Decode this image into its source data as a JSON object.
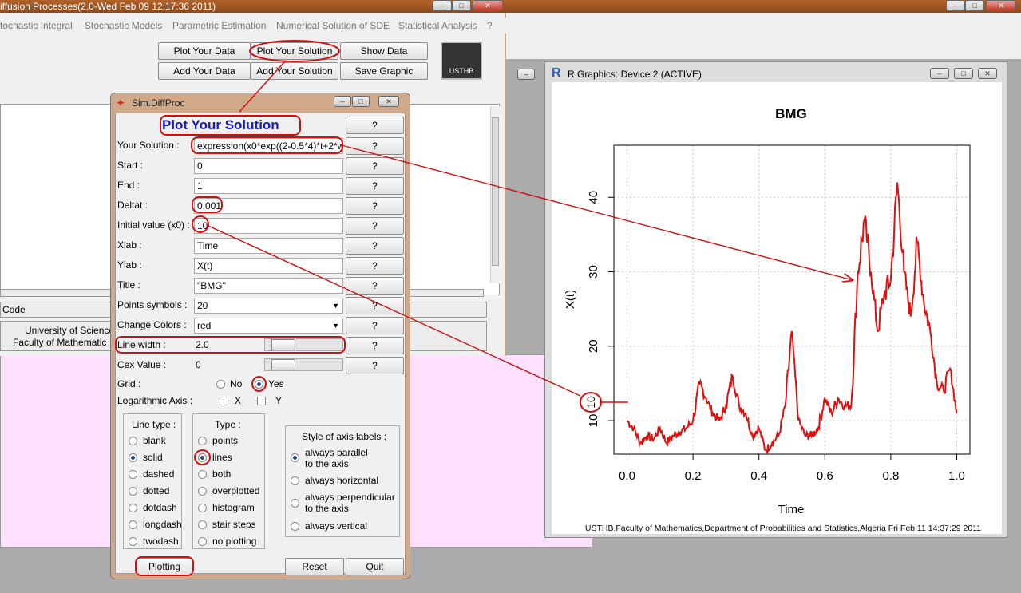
{
  "top_window": {
    "title": "iffusion Processes(2.0-Wed Feb 09 12:17:36 2011)"
  },
  "menu": [
    "tochastic Integral",
    "Stochastic Models",
    "Parametric Estimation",
    "Numerical Solution of SDE",
    "Statistical Analysis",
    "?"
  ],
  "toolbar": {
    "plot_data": "Plot Your Data",
    "plot_solution": "Plot Your Solution",
    "show_data": "Show Data",
    "add_data": "Add Your Data",
    "add_solution": "Add Your Solution",
    "save_graphic": "Save Graphic",
    "logo_text": "USTHB"
  },
  "main_footer": {
    "code_label": "Code",
    "univ": "University of Science",
    "faculty": "Faculty of Mathematic"
  },
  "dialog": {
    "title": "Sim.DiffProc",
    "heading": "Plot Your Solution",
    "help": "?",
    "fields": [
      {
        "label": "Your Solution :",
        "value": "expression(x0*exp((2-0.5*4)*t+2*w"
      },
      {
        "label": "Start :",
        "value": "0"
      },
      {
        "label": "End :",
        "value": "1"
      },
      {
        "label": "Deltat :",
        "value": "0.001"
      },
      {
        "label": "Initial value (x0) :",
        "value": "10"
      },
      {
        "label": "Xlab :",
        "value": "Time"
      },
      {
        "label": "Ylab :",
        "value": "X(t)"
      },
      {
        "label": "Title :",
        "value": "\"BMG\""
      }
    ],
    "points_symbols": {
      "label": "Points symbols :",
      "value": "20"
    },
    "change_colors": {
      "label": "Change Colors :",
      "value": "red"
    },
    "line_width": {
      "label": "Line width :",
      "value": "2.0",
      "level": 0.12
    },
    "cex_value": {
      "label": "Cex Value :",
      "value": "0",
      "level": 0.12
    },
    "grid": {
      "label": "Grid :",
      "no": "No",
      "yes": "Yes",
      "selected": "Yes"
    },
    "log_axis": {
      "label": "Logarithmic Axis :",
      "x": "X",
      "y": "Y"
    },
    "line_type": {
      "title": "Line type :",
      "options": [
        "blank",
        "solid",
        "dashed",
        "dotted",
        "dotdash",
        "longdash",
        "twodash"
      ],
      "selected": 1
    },
    "type": {
      "title": "Type :",
      "options": [
        "points",
        "lines",
        "both",
        "overplotted",
        "histogram",
        "stair steps",
        "no plotting"
      ],
      "selected": 1
    },
    "axis_style": {
      "title": "Style of axis labels :",
      "options": [
        "always parallel to the axis",
        "always horizontal",
        "always perpendicular to the axis",
        "always vertical"
      ],
      "selected": 0
    },
    "plotting": "Plotting",
    "reset": "Reset",
    "quit": "Quit"
  },
  "rwindow": {
    "title": "R Graphics: Device 2 (ACTIVE)",
    "logo": "R"
  },
  "chart_data": {
    "type": "line",
    "title": "BMG",
    "xlabel": "Time",
    "ylabel": "X(t)",
    "xlim": [
      -0.04,
      1.04
    ],
    "ylim": [
      5.5,
      47
    ],
    "xticks": [
      "0.0",
      "0.2",
      "0.4",
      "0.6",
      "0.8",
      "1.0"
    ],
    "yticks": [
      "10",
      "20",
      "30",
      "40"
    ],
    "grid": true,
    "color": "#e01010",
    "x": [
      0.0,
      0.02,
      0.04,
      0.06,
      0.08,
      0.1,
      0.12,
      0.14,
      0.16,
      0.18,
      0.2,
      0.22,
      0.24,
      0.26,
      0.28,
      0.3,
      0.32,
      0.34,
      0.36,
      0.38,
      0.4,
      0.42,
      0.44,
      0.46,
      0.48,
      0.5,
      0.52,
      0.54,
      0.56,
      0.58,
      0.6,
      0.62,
      0.64,
      0.66,
      0.68,
      0.7,
      0.72,
      0.74,
      0.76,
      0.78,
      0.8,
      0.82,
      0.84,
      0.86,
      0.88,
      0.9,
      0.92,
      0.94,
      0.96,
      0.98,
      1.0
    ],
    "y": [
      10,
      9,
      7,
      8,
      7.5,
      9,
      7,
      8,
      8.5,
      9,
      10,
      15,
      13,
      11,
      10,
      12,
      16,
      12,
      11,
      8,
      9,
      6,
      7,
      8,
      12,
      22,
      10,
      8,
      8,
      9,
      13,
      11,
      13,
      12,
      12,
      30,
      37,
      30,
      22,
      27,
      29,
      42,
      30,
      24,
      34,
      26,
      22,
      15,
      14,
      17,
      11
    ],
    "footer": "USTHB,Faculty of Mathematics,Department of Probabilities and Statistics,Algeria Fri Feb 11 14:37:29 2011"
  },
  "annotation": {
    "x0_marker": "10"
  }
}
